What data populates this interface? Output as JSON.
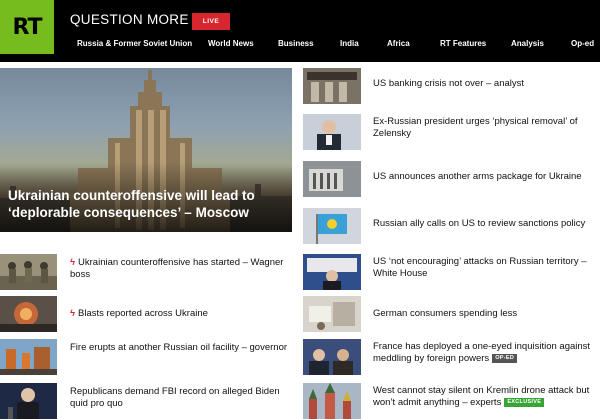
{
  "header": {
    "logo": "RT",
    "slogan": "QUESTION MORE",
    "live_label": "LIVE",
    "nav": [
      "Russia & Former Soviet Union",
      "World News",
      "Business",
      "India",
      "Africa",
      "RT Features",
      "Analysis",
      "Op-ed"
    ]
  },
  "hero": {
    "title": "Ukrainian counteroffensive will lead to ‘deplorable consequences’ – Moscow"
  },
  "left_list": [
    {
      "title": "Ukrainian counteroffensive has started – Wagner boss",
      "breaking": true
    },
    {
      "title": "Blasts reported across Ukraine",
      "breaking": true
    },
    {
      "title": "Fire erupts at another Russian oil facility – governor",
      "breaking": false
    },
    {
      "title": "Republicans demand FBI record on alleged Biden quid pro quo",
      "breaking": false
    }
  ],
  "right_list": [
    {
      "title": "US banking crisis not over – analyst",
      "badge": ""
    },
    {
      "title": "Ex-Russian president urges ‘physical removal’ of Zelensky",
      "badge": ""
    },
    {
      "title": "US announces another arms package for Ukraine",
      "badge": ""
    },
    {
      "title": "Russian ally calls on US to review sanctions policy",
      "badge": ""
    },
    {
      "title": "US ‘not encouraging’ attacks on Russian territory – White House",
      "badge": ""
    },
    {
      "title": "German consumers spending less",
      "badge": ""
    },
    {
      "title": "France has deployed a one-eyed inquisition against meddling by foreign powers",
      "badge": "OP-ED"
    },
    {
      "title": "West cannot stay silent on Kremlin drone attack but won’t admit anything – experts",
      "badge": "EXCLUSIVE"
    }
  ],
  "colors": {
    "brand_green": "#77bc1f",
    "live_red": "#d8262e",
    "header_bg": "#000000",
    "oped_badge": "#555555",
    "exclusive_badge": "#3aa537"
  }
}
